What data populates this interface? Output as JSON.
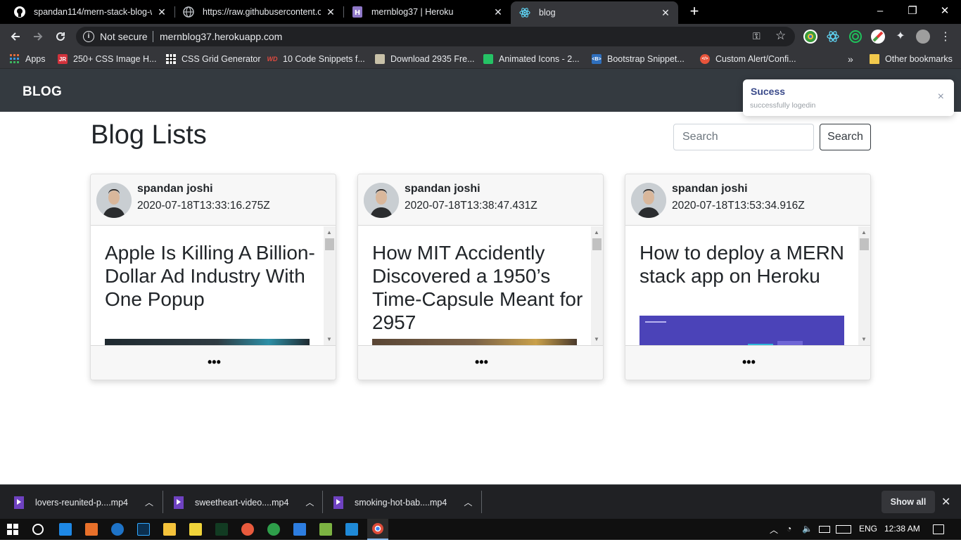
{
  "browser": {
    "tabs": [
      {
        "title": "spandan114/mern-stack-blog-wi",
        "active": false
      },
      {
        "title": "https://raw.githubusercontent.co",
        "active": false
      },
      {
        "title": "mernblog37 | Heroku",
        "active": false
      },
      {
        "title": "blog",
        "active": true
      }
    ],
    "new_tab_glyph": "+",
    "security_label": "Not secure",
    "url": "mernblog37.herokuapp.com",
    "bookmarks": [
      {
        "label": "Apps",
        "icon": "apps-grid-icon"
      },
      {
        "label": "250+ CSS Image H...",
        "icon": "jr-icon",
        "badge": "JR",
        "color": "#d2323c"
      },
      {
        "label": "CSS Grid Generator",
        "icon": "grid-icon"
      },
      {
        "label": "10 Code Snippets f...",
        "icon": "wd-icon",
        "badge": "WD",
        "color": "#e04a3f"
      },
      {
        "label": "Download 2935 Fre...",
        "icon": "image-icon"
      },
      {
        "label": "Animated Icons - 2...",
        "icon": "animated-icons-icon",
        "color": "#25c265"
      },
      {
        "label": "Bootstrap Snippet...",
        "icon": "bootstrap-icon",
        "badge": "<B>",
        "color": "#2f6fbd"
      },
      {
        "label": "Custom Alert/Confi...",
        "icon": "code-icon",
        "badge": "</>",
        "color": "#e8543b"
      }
    ],
    "overflow_glyph": "»",
    "other_bookmarks": "Other bookmarks"
  },
  "app": {
    "brand": "BLOG",
    "heading": "Blog Lists",
    "search": {
      "placeholder": "Search",
      "button_label": "Search"
    },
    "toast": {
      "title": "Sucess",
      "message": "successfully logedin",
      "close": "×"
    },
    "posts": [
      {
        "author": "spandan joshi",
        "date": "2020-07-18T13:33:16.275Z",
        "title": "Apple Is Killing A Billion-Dollar Ad Industry With One Popup",
        "more": "•••"
      },
      {
        "author": "spandan joshi",
        "date": "2020-07-18T13:38:47.431Z",
        "title": "How MIT Accidently Discovered a 1950’s Time-Capsule Meant for 2957",
        "more": "•••"
      },
      {
        "author": "spandan joshi",
        "date": "2020-07-18T13:53:34.916Z",
        "title": "How to deploy a MERN stack app on Heroku",
        "more": "•••"
      }
    ],
    "colors": {
      "navbar": "#343a40",
      "toast_title": "#3a4a8a"
    }
  },
  "downloads": {
    "items": [
      {
        "name": "lovers-reunited-p....mp4"
      },
      {
        "name": "sweetheart-video....mp4"
      },
      {
        "name": "smoking-hot-bab....mp4"
      }
    ],
    "show_all": "Show all"
  },
  "taskbar": {
    "lang": "ENG",
    "time": "12:38 AM"
  }
}
